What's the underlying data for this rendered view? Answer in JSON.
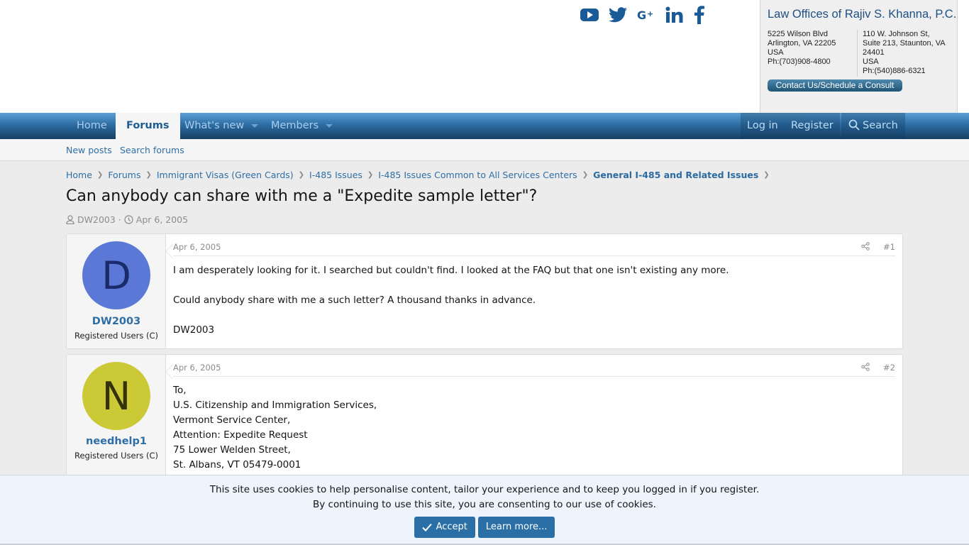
{
  "header": {
    "social_icons": [
      "youtube-icon",
      "twitter-icon",
      "google-plus-icon",
      "linkedin-icon",
      "facebook-icon"
    ],
    "law_office": {
      "title": "Law Offices of Rajiv S. Khanna, P.C.",
      "office1": [
        "5225 Wilson Blvd",
        "Arlington, VA 22205",
        "USA",
        "Ph:(703)908-4800"
      ],
      "office2": [
        "110 W. Johnson St,",
        "Suite 213, Staunton, VA",
        "24401",
        "USA",
        "Ph:(540)886-6321"
      ],
      "button": "Contact Us/Schedule a Consult"
    }
  },
  "nav": {
    "tabs": [
      {
        "label": "Home"
      },
      {
        "label": "Forums",
        "active": true
      },
      {
        "label": "What's new",
        "dropdown": true
      },
      {
        "label": "Members",
        "dropdown": true
      }
    ],
    "login": "Log in",
    "register": "Register",
    "search": "Search",
    "subnav": [
      "New posts",
      "Search forums"
    ]
  },
  "breadcrumb": [
    "Home",
    "Forums",
    "Immigrant Visas (Green Cards)",
    "I-485 Issues",
    "I-485 Issues Common to All Services Centers",
    "General I-485 and Related Issues"
  ],
  "thread": {
    "title": "Can anybody can share with me a \"Expedite sample letter\"?",
    "author": "DW2003",
    "separator": "·",
    "date": "Apr 6, 2005"
  },
  "posts": [
    {
      "avatar_letter": "D",
      "avatar_bg": "#5b78d6",
      "avatar_fg": "#192b6a",
      "username": "DW2003",
      "user_title": "Registered Users (C)",
      "date": "Apr 6, 2005",
      "number": "#1",
      "lines": [
        "I am desperately looking for it. I searched but couldn't find. I looked at the FAQ but that one isn't existing any more.",
        "",
        "Could anybody share with me a such letter? A thousand thanks in advance.",
        "",
        "DW2003"
      ]
    },
    {
      "avatar_letter": "N",
      "avatar_bg": "#ccc936",
      "avatar_fg": "#33320a",
      "username": "needhelp1",
      "user_title": "Registered Users (C)",
      "date": "Apr 6, 2005",
      "number": "#2",
      "lines": [
        "To,",
        "U.S. Citizenship and Immigration Services,",
        "Vermont Service Center,",
        "Attention: Expedite Request",
        "75 Lower Welden Street,",
        "St. Albans, VT 05479-0001"
      ]
    }
  ],
  "cookie": {
    "line1": "This site uses cookies to help personalise content, tailor your experience and to keep you logged in if you register.",
    "line2": "By continuing to use this site, you are consenting to our use of cookies.",
    "accept": "Accept",
    "learn_more": "Learn more..."
  }
}
